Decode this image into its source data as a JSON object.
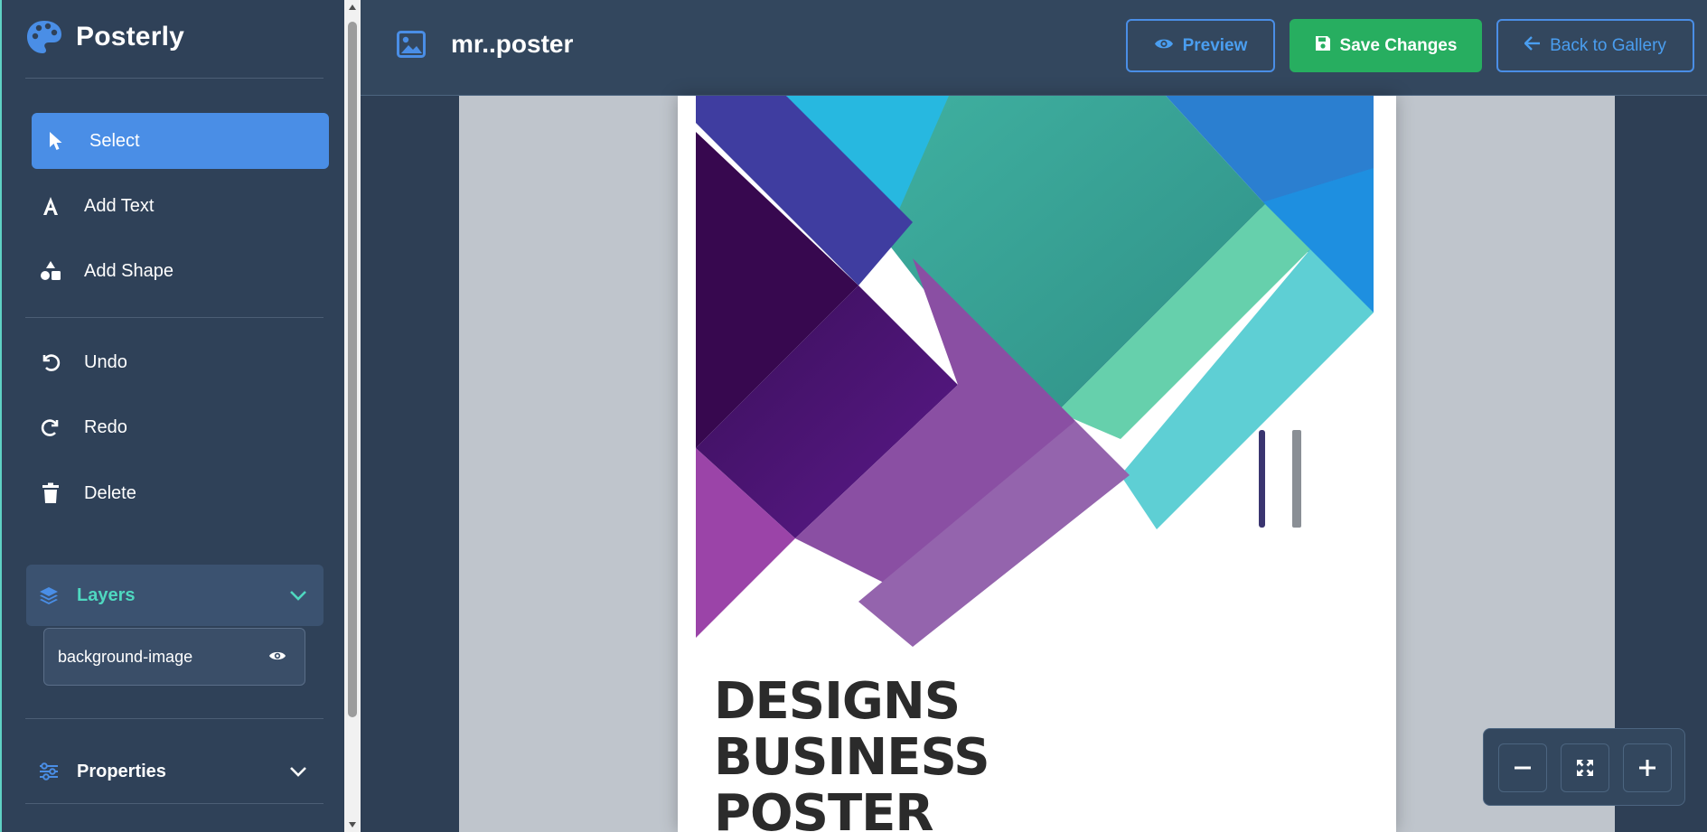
{
  "app": {
    "name": "Posterly"
  },
  "tools": [
    {
      "label": "Select",
      "icon": "pointer-icon",
      "active": true
    },
    {
      "label": "Add Text",
      "icon": "text-icon",
      "active": false
    },
    {
      "label": "Add Shape",
      "icon": "shapes-icon",
      "active": false
    }
  ],
  "history": [
    {
      "label": "Undo",
      "icon": "undo-icon"
    },
    {
      "label": "Redo",
      "icon": "redo-icon"
    },
    {
      "label": "Delete",
      "icon": "trash-icon"
    }
  ],
  "layers": {
    "title": "Layers",
    "expanded": true,
    "items": [
      {
        "name": "background-image",
        "visible": true
      }
    ]
  },
  "properties": {
    "title": "Properties",
    "expanded": false
  },
  "header": {
    "document_title": "mr..poster",
    "preview_label": "Preview",
    "save_label": "Save Changes",
    "back_label": "Back to Gallery"
  },
  "poster": {
    "headline_lines": [
      "DESIGNS",
      "BUSINESS",
      "POSTER"
    ]
  },
  "colors": {
    "sidebar_bg": "#2f4158",
    "header_bg": "#33475e",
    "accent_blue": "#4a8ee6",
    "accent_teal": "#4fd8c0",
    "save_green": "#27ae60"
  }
}
